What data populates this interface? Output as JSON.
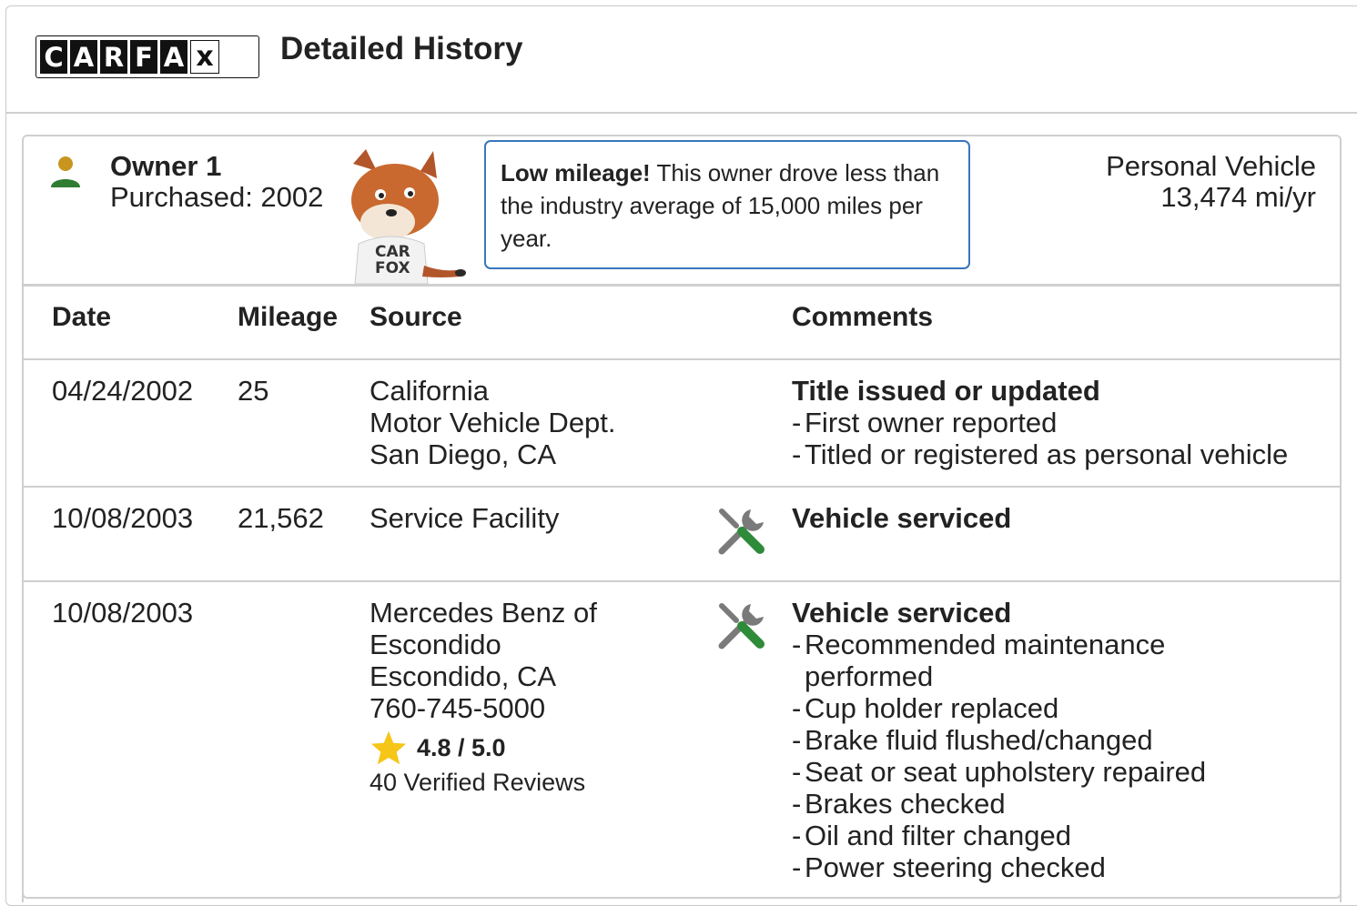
{
  "header": {
    "logo_letters": [
      "C",
      "A",
      "R",
      "F",
      "A",
      "X"
    ],
    "title": "Detailed History"
  },
  "owner": {
    "name": "Owner 1",
    "purchased": "Purchased: 2002",
    "callout_bold": "Low mileage!",
    "callout_text": " This owner drove less than the industry average of 15,000 miles per year.",
    "vehicle_type": "Personal Vehicle",
    "miles_per_year": "13,474 mi/yr",
    "icon_color": "#2e7d32",
    "head_color": "#c8961e"
  },
  "table": {
    "headers": {
      "date": "Date",
      "mileage": "Mileage",
      "source": "Source",
      "comments": "Comments"
    },
    "rows": [
      {
        "date": "04/24/2002",
        "mileage": "25",
        "source": [
          "California",
          "Motor Vehicle Dept.",
          "San Diego, CA"
        ],
        "comment_title": "Title issued or updated",
        "comments": [
          "First owner reported",
          "Titled or registered as personal vehicle"
        ]
      },
      {
        "date": "10/08/2003",
        "mileage": "21,562",
        "source": [
          "Service Facility"
        ],
        "comment_title": "Vehicle serviced",
        "comments": []
      },
      {
        "date": "10/08/2003",
        "mileage": "",
        "source": [
          "Mercedes Benz of",
          "Escondido",
          "Escondido, CA",
          "760-745-5000"
        ],
        "rating": "4.8 / 5.0",
        "reviews": "40 Verified Reviews",
        "comment_title": "Vehicle serviced",
        "comments": [
          "Recommended maintenance",
          "performed",
          "Cup holder replaced",
          "Brake fluid flushed/changed",
          "Seat or seat upholstery repaired",
          "Brakes checked",
          "Oil and filter changed",
          "Power steering checked"
        ]
      }
    ]
  },
  "colors": {
    "accent_blue": "#3777bc",
    "service_green": "#2e8b3a",
    "star": "#f5c518"
  }
}
